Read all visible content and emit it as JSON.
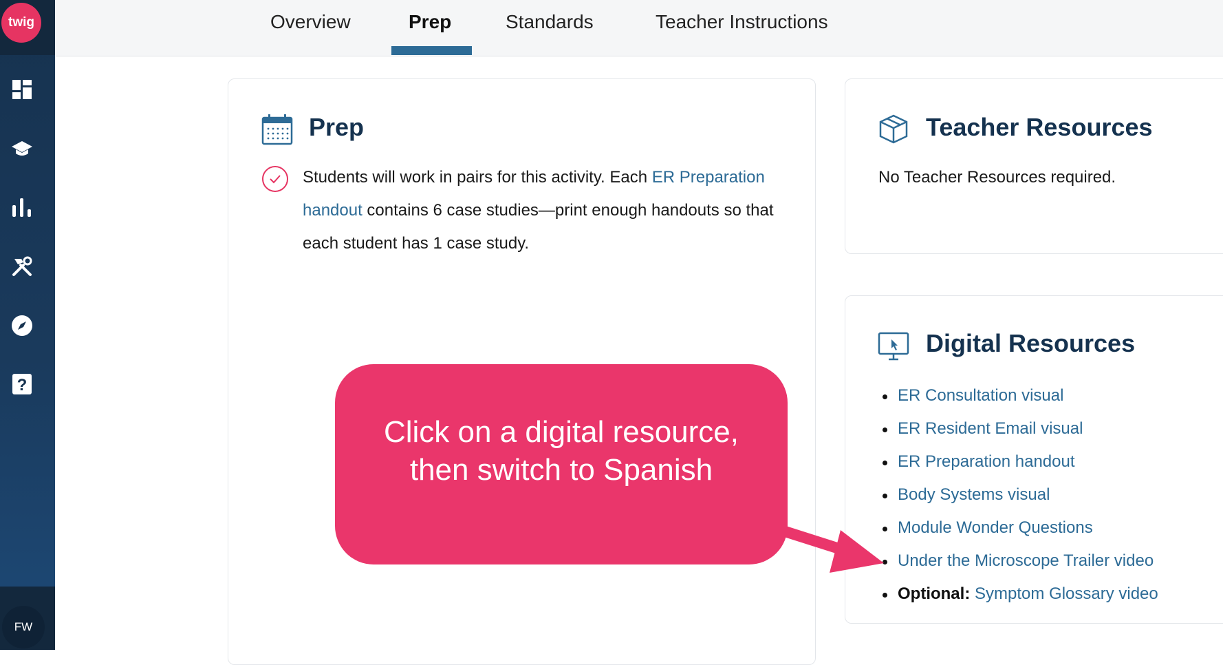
{
  "sidebar": {
    "logo": "twig",
    "icons": [
      "dashboard-icon",
      "graduation-cap-icon",
      "bar-chart-icon",
      "tools-icon",
      "compass-icon",
      "help-icon"
    ],
    "avatar": "FW"
  },
  "tabs": [
    {
      "label": "Overview",
      "active": false
    },
    {
      "label": "Prep",
      "active": true
    },
    {
      "label": "Standards",
      "active": false
    },
    {
      "label": "Teacher Instructions",
      "active": false
    }
  ],
  "prep": {
    "title": "Prep",
    "text_1": "Students will work in pairs for this activity. Each ",
    "link": "ER Preparation handout",
    "text_2": " contains 6 case studies—print enough handouts so that each student has 1 case study."
  },
  "teacher_resources": {
    "title": "Teacher Resources",
    "text": "No Teacher Resources required."
  },
  "digital_resources": {
    "title": "Digital Resources",
    "items": [
      "ER Consultation visual",
      "ER Resident Email visual",
      "ER Preparation handout",
      "Body Systems visual",
      "Module Wonder Questions",
      "Under the Microscope Trailer video"
    ],
    "optional_label": "Optional:",
    "optional_item": " Symptom Glossary video"
  },
  "callout": {
    "text": "Click on a digital resource, then switch to Spanish"
  },
  "colors": {
    "sidebar": "#16324f",
    "accent": "#e63462",
    "link": "#2d6b96",
    "callout": "#ea366b"
  }
}
